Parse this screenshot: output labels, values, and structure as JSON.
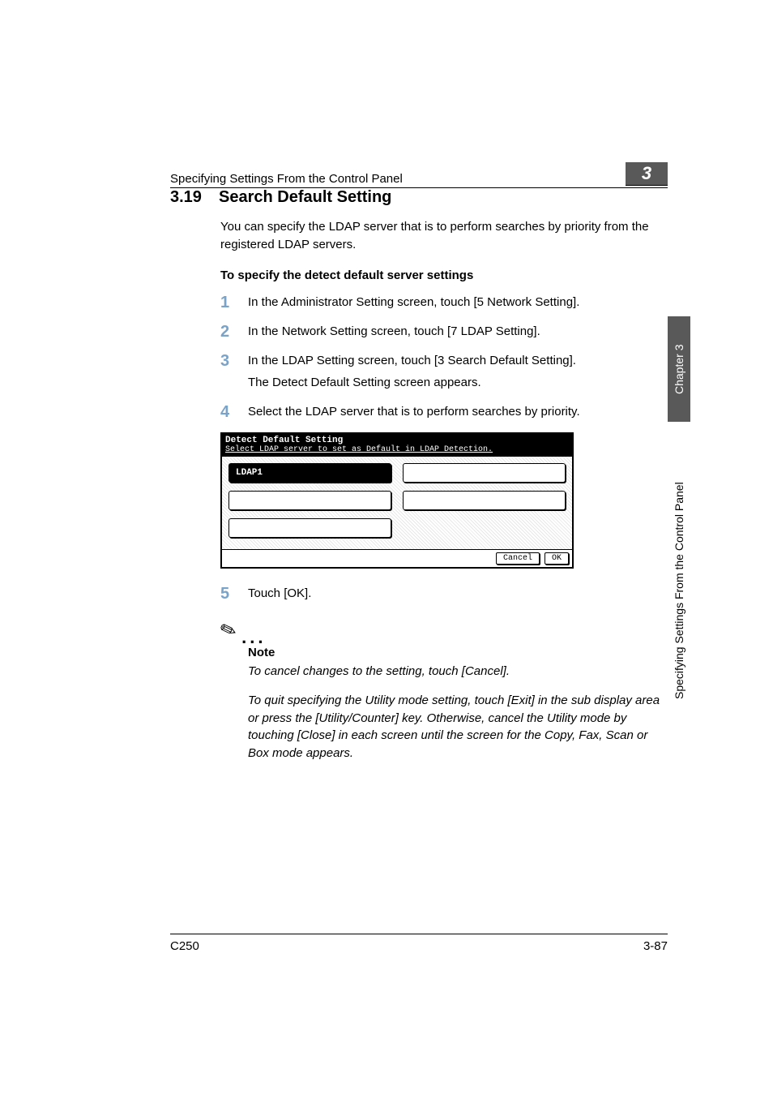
{
  "header": {
    "running": "Specifying Settings From the Control Panel",
    "chapter_number": "3"
  },
  "section": {
    "number": "3.19",
    "title": "Search Default Setting",
    "intro": "You can specify the LDAP server that is to perform searches by priority from the registered LDAP servers.",
    "sub_heading": "To specify the detect default server settings"
  },
  "steps": [
    {
      "num": "1",
      "text": "In the Administrator Setting screen, touch [5 Network Setting]."
    },
    {
      "num": "2",
      "text": "In the Network Setting screen, touch [7 LDAP Setting]."
    },
    {
      "num": "3",
      "text": "In the LDAP Setting screen, touch [3 Search Default Setting].",
      "sub": "The Detect Default Setting screen appears."
    },
    {
      "num": "4",
      "text": "Select the LDAP server that is to perform searches by priority."
    },
    {
      "num": "5",
      "text": "Touch [OK]."
    }
  ],
  "screenshot": {
    "title": "Detect Default Setting",
    "subtitle": "Select LDAP server to set as Default in LDAP Detection.",
    "slots": [
      "LDAP1",
      "",
      "",
      "",
      ""
    ],
    "cancel": "Cancel",
    "ok": "OK"
  },
  "note": {
    "label": "Note",
    "p1": "To cancel changes to the setting, touch [Cancel].",
    "p2": "To quit specifying the Utility mode setting, touch [Exit] in the sub display area or press the [Utility/Counter] key. Otherwise, cancel the Utility mode by touching [Close] in each screen until the screen for the Copy, Fax, Scan or Box mode appears."
  },
  "side_tabs": {
    "dark": "Chapter 3",
    "light": "Specifying Settings From the Control Panel"
  },
  "footer": {
    "left": "C250",
    "right": "3-87"
  }
}
